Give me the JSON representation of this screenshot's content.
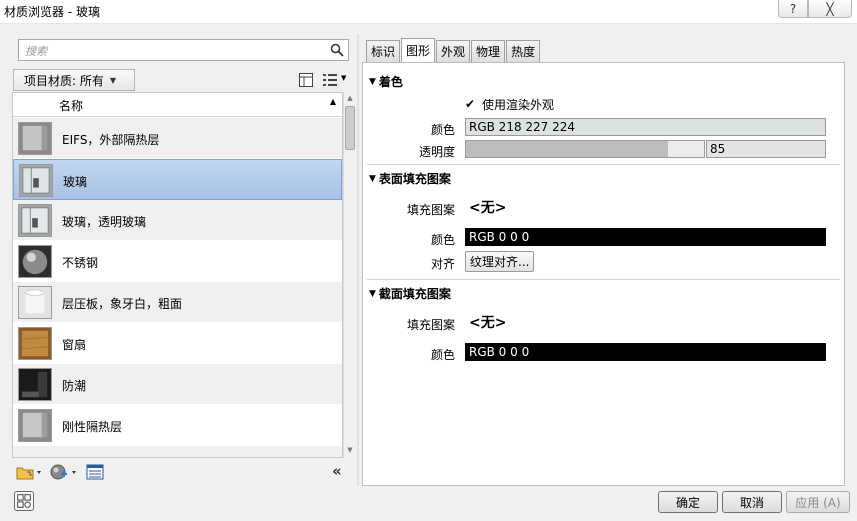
{
  "window": {
    "title": "材质浏览器 - 玻璃",
    "help_label": "?",
    "close_label": "╳"
  },
  "search": {
    "placeholder": "搜索"
  },
  "breadcrumb": {
    "label": "项目材质: 所有"
  },
  "list": {
    "header": "名称",
    "items": [
      {
        "label": "EIFS，外部隔热层",
        "thumb": "wall-gray"
      },
      {
        "label": "玻璃",
        "thumb": "glass"
      },
      {
        "label": "玻璃，透明玻璃",
        "thumb": "glass-clear"
      },
      {
        "label": "不锈钢",
        "thumb": "steel-sphere"
      },
      {
        "label": "层压板，象牙白，粗面",
        "thumb": "laminate-cylinder"
      },
      {
        "label": "窗扇",
        "thumb": "wood"
      },
      {
        "label": "防潮",
        "thumb": "dark"
      },
      {
        "label": "刚性隔热层",
        "thumb": "wall-gray"
      }
    ],
    "selected_index": 1
  },
  "tabs": [
    {
      "label": "标识",
      "active": false
    },
    {
      "label": "图形",
      "active": true
    },
    {
      "label": "外观",
      "active": false
    },
    {
      "label": "物理",
      "active": false
    },
    {
      "label": "热度",
      "active": false
    }
  ],
  "shading": {
    "title": "着色",
    "use_render_label": "使用渲染外观",
    "use_render_checked": true,
    "color_label": "颜色",
    "color_value": "RGB 218 227 224",
    "color_hex": "#dae3e0",
    "transparency_label": "透明度",
    "transparency_value": "85",
    "transparency_fraction": 0.85
  },
  "surface_pattern": {
    "title": "表面填充图案",
    "pattern_label": "填充图案",
    "pattern_value": "<无>",
    "color_label": "颜色",
    "color_value": "RGB 0 0 0",
    "align_label": "对齐",
    "align_button": "纹理对齐..."
  },
  "cut_pattern": {
    "title": "截面填充图案",
    "pattern_label": "填充图案",
    "pattern_value": "<无>",
    "color_label": "颜色",
    "color_value": "RGB 0 0 0"
  },
  "buttons": {
    "ok": "确定",
    "cancel": "取消",
    "apply": "应用 (A)"
  },
  "colors": {
    "selection": "#a8c2e6",
    "black_swatch": "#000000"
  }
}
